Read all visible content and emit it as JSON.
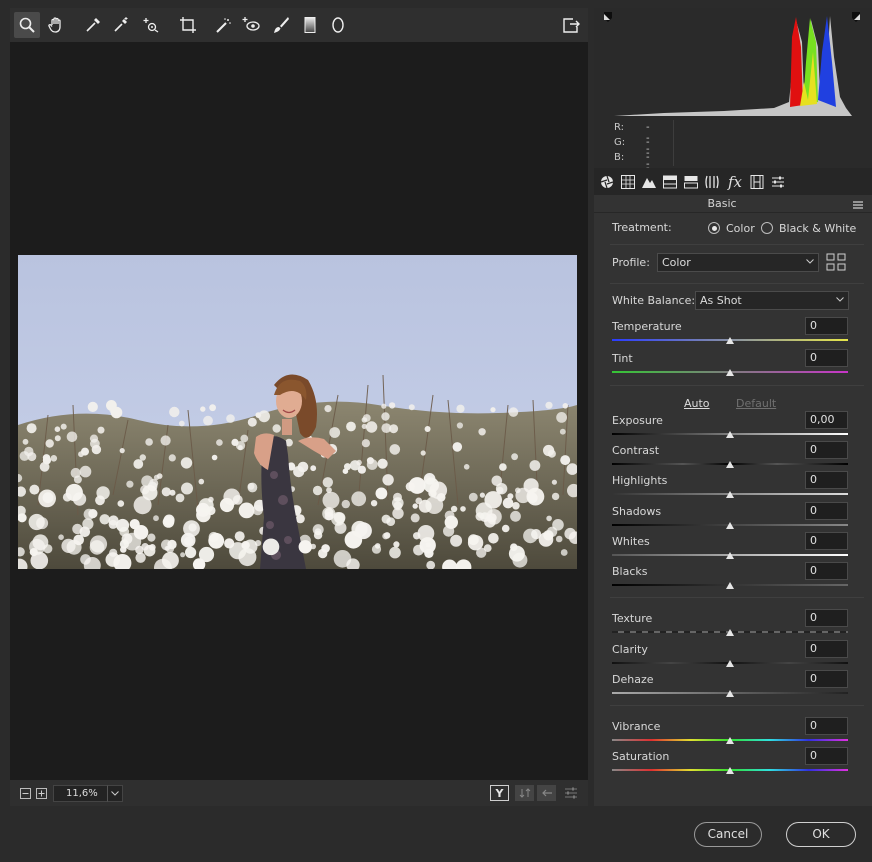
{
  "toolbar": {
    "tools": [
      "zoom-icon",
      "hand-icon",
      "white-balance-eyedropper-icon",
      "color-sampler-icon",
      "targeted-adjustment-icon",
      "crop-icon",
      "spot-removal-icon",
      "red-eye-icon",
      "adjustment-brush-icon",
      "graduated-filter-icon",
      "radial-filter-icon"
    ],
    "open_preferences_icon": "export-icon"
  },
  "status": {
    "zoom": "11,6%"
  },
  "histogram": {
    "r_label": "R:",
    "r_value": "---",
    "g_label": "G:",
    "g_value": "---",
    "b_label": "B:",
    "b_value": "---"
  },
  "panel": {
    "title": "Basic",
    "treatment_label": "Treatment:",
    "treatment_color": "Color",
    "treatment_bw": "Black & White",
    "profile_label": "Profile:",
    "profile_value": "Color",
    "wb_label": "White Balance:",
    "wb_value": "As Shot",
    "auto_link": "Auto",
    "default_link": "Default",
    "sliders": {
      "temperature": {
        "label": "Temperature",
        "value": "0"
      },
      "tint": {
        "label": "Tint",
        "value": "0"
      },
      "exposure": {
        "label": "Exposure",
        "value": "0,00"
      },
      "contrast": {
        "label": "Contrast",
        "value": "0"
      },
      "highlights": {
        "label": "Highlights",
        "value": "0"
      },
      "shadows": {
        "label": "Shadows",
        "value": "0"
      },
      "whites": {
        "label": "Whites",
        "value": "0"
      },
      "blacks": {
        "label": "Blacks",
        "value": "0"
      },
      "texture": {
        "label": "Texture",
        "value": "0"
      },
      "clarity": {
        "label": "Clarity",
        "value": "0"
      },
      "dehaze": {
        "label": "Dehaze",
        "value": "0"
      },
      "vibrance": {
        "label": "Vibrance",
        "value": "0"
      },
      "saturation": {
        "label": "Saturation",
        "value": "0"
      }
    }
  },
  "footer": {
    "cancel": "Cancel",
    "ok": "OK"
  }
}
